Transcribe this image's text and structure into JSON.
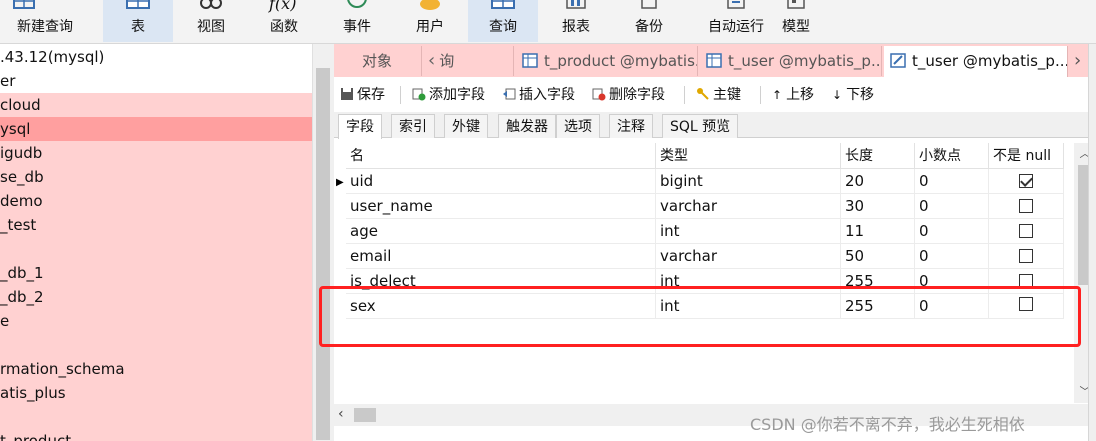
{
  "ribbon": {
    "buttons": [
      {
        "label": "新建查询",
        "icon": "new-query-icon"
      },
      {
        "label": "表",
        "icon": "table-icon"
      },
      {
        "label": "视图",
        "icon": "view-icon"
      },
      {
        "label": "函数",
        "icon": "function-icon"
      },
      {
        "label": "事件",
        "icon": "event-icon"
      },
      {
        "label": "用户",
        "icon": "user-icon"
      },
      {
        "label": "查询",
        "icon": "query-icon"
      },
      {
        "label": "报表",
        "icon": "report-icon"
      },
      {
        "label": "备份",
        "icon": "backup-icon"
      },
      {
        "label": "自动运行",
        "icon": "automation-icon"
      },
      {
        "label": "模型",
        "icon": "model-icon"
      }
    ],
    "function_glyph": "f(x)"
  },
  "tree": {
    "items": [
      ".43.12(mysql)",
      "er",
      "cloud",
      "ysql",
      "igudb",
      "se_db",
      "demo",
      "_test",
      "",
      "_db_1",
      "_db_2",
      "e",
      "",
      "rmation_schema",
      "atis_plus",
      "",
      "t_product"
    ]
  },
  "tabs": {
    "objects_label": "对象",
    "partial_label": "询",
    "items": [
      "t_product @mybatis...",
      "t_user @mybatis_p...",
      "t_user @mybatis_p..."
    ],
    "overflow_glyph": "›"
  },
  "toolbar": {
    "save": "保存",
    "add_field": "添加字段",
    "insert_field": "插入字段",
    "delete_field": "删除字段",
    "primary_key": "主键",
    "move_up": "上移",
    "move_down": "下移"
  },
  "subtabs": [
    "字段",
    "索引",
    "外键",
    "触发器",
    "选项",
    "注释",
    "SQL 预览"
  ],
  "grid": {
    "headers": {
      "name": "名",
      "type": "类型",
      "length": "长度",
      "decimals": "小数点",
      "not_null": "不是 null"
    },
    "rows": [
      {
        "name": "uid",
        "type": "bigint",
        "length": "20",
        "decimals": "0",
        "not_null": true,
        "current": true
      },
      {
        "name": "user_name",
        "type": "varchar",
        "length": "30",
        "decimals": "0",
        "not_null": false
      },
      {
        "name": "age",
        "type": "int",
        "length": "11",
        "decimals": "0",
        "not_null": false
      },
      {
        "name": "email",
        "type": "varchar",
        "length": "50",
        "decimals": "0",
        "not_null": false
      },
      {
        "name": "is_delect",
        "type": "int",
        "length": "255",
        "decimals": "0",
        "not_null": false
      },
      {
        "name": "sex",
        "type": "int",
        "length": "255",
        "decimals": "0",
        "not_null": false
      }
    ]
  },
  "watermark": "CSDN @你若不离不弃，我必生死相依",
  "colors": {
    "tree_highlight": "#ffd1d1",
    "tree_selected": "#ff9f9f",
    "annotation_box": "#ff2020",
    "ribbon_active": "#dbe6f3"
  }
}
